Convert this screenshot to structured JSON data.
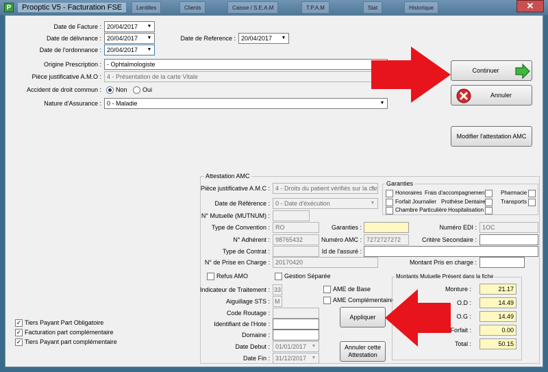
{
  "window": {
    "title": "Prooptic V5 - Facturation FSE",
    "app_icon": "P",
    "taskbar": [
      "Lentilles",
      "Clients",
      "Caisse / S.E.A.M",
      "T.P.A.M",
      "Stat",
      "Historique"
    ]
  },
  "dates": {
    "facture_label": "Date de Facture :",
    "facture": "20/04/2017",
    "delivrance_label": "Date de délivrance :",
    "delivrance": "20/04/2017",
    "ordonnance_label": "Date de l'ordonnance :",
    "ordonnance": "20/04/2017",
    "reference_label": "Date de Reference :",
    "reference": "20/04/2017"
  },
  "prescription": {
    "origine_label": "Origine Prescription :",
    "origine": " - Ophtalmologiste",
    "piece_amo_label": "Pièce justificative A.M.O :",
    "piece_amo": "4 - Présentation de la carte Vitale",
    "accident_label": "Accident de droit commun :",
    "non": "Non",
    "oui": "Oui",
    "nature_label": "Nature d'Assurance :",
    "nature": "0 - Maladie"
  },
  "buttons": {
    "continuer": "Continuer",
    "annuler": "Annuler",
    "modifier": "Modifier l'attestation AMC",
    "appliquer": "Appliquer",
    "annuler_attestation": "Annuler cette Attestation"
  },
  "attestation": {
    "title": "Attestation AMC",
    "piece_label": "Pièce justificative A.M.C :",
    "piece": "4 - Droits du patient vérifiés sur la car",
    "date_ref_label": "Date de Référence :",
    "date_ref": "0 - Date d'éxécution",
    "mutuelle_label": "N° Mutuelle (MUTNUM) :",
    "mutuelle": "",
    "convention_label": "Type de Convention :",
    "convention": "RO",
    "garanties_label": "Garanties :",
    "garanties": "",
    "edi_label": "Numéro EDI :",
    "edi": "1OC",
    "adherent_label": "N° Adhérent :",
    "adherent": "98765432",
    "amc_label": "Numéro AMC :",
    "amc": "7272727272",
    "critere_label": "Critère Secondaire :",
    "critere": "",
    "contrat_label": "Type de Contrat :",
    "contrat": "",
    "assure_label": "Id de l'assuré :",
    "assure": "",
    "prise_label": "N° de Prise en Charge :",
    "prise": "20170420",
    "montant_pris_label": "Montant Pris en charge :",
    "montant_pris": "",
    "refus_amo": "Refus AMO",
    "gestion_separee": "Gestion Séparée",
    "indicateur_label": "Indicateur de Traitement :",
    "indicateur": "33",
    "aiguillage_label": "Aiguillage STS :",
    "aiguillage": "M",
    "routage_label": "Code Routage :",
    "routage": "",
    "hote_label": "Identifiant de l'Hote :",
    "hote": "",
    "domaine_label": "Domaine :",
    "domaine": "",
    "debut_label": "Date Debut :",
    "debut": "01/01/2017",
    "fin_label": "Date Fin :",
    "fin": "31/12/2017",
    "ame_base": "AME de Base",
    "ame_comp": "AME Complémentaire"
  },
  "garanties_box": {
    "title": "Garanties",
    "honoraires": "Honoraires",
    "frais": "Frais d'accompagnement",
    "pharmacie": "Pharmacie",
    "forfait": "Forfait Journalier",
    "prothese": "Prothèse Dentaire",
    "transports": "Transports",
    "chambre": "Chambre Particulière",
    "hospitalisation": "Hospitalisation"
  },
  "montants": {
    "title": "Montants Mutuelle Présent dans la fiche",
    "monture_label": "Monture :",
    "monture": "21.17",
    "od_label": "O.D :",
    "od": "14.49",
    "og_label": "O.G :",
    "og": "14.49",
    "forfait_label": "Forfait :",
    "forfait": "0.00",
    "total_label": "Total :",
    "total": "50.15"
  },
  "tiers": {
    "obligatoire": "Tiers Payant Part Obligatoire",
    "facturation": "Facturation part complémentaire",
    "complementaire": "Tiers Payant part complémentaire"
  },
  "colors": {
    "arrow": "#e8141c",
    "continue_arrow": "#3cb83c",
    "cancel_icon": "#d42a2a",
    "highlight": "#fff8c0"
  }
}
